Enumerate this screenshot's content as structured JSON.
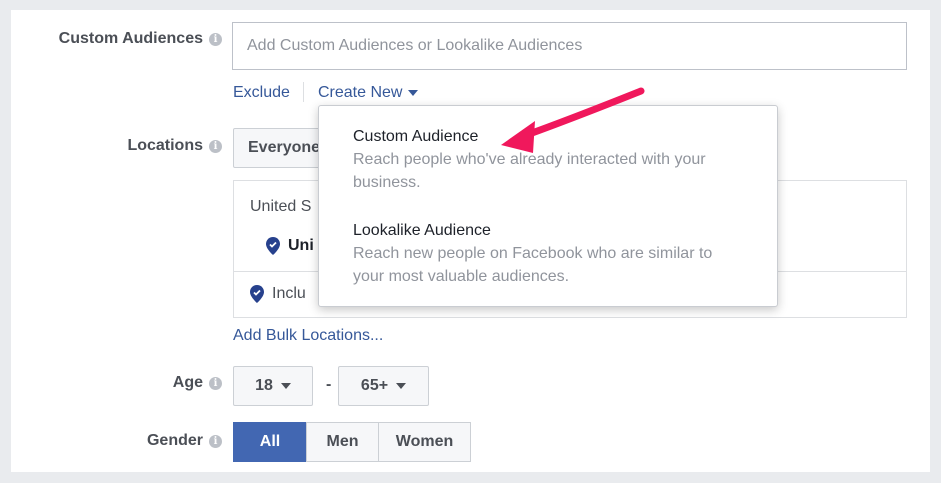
{
  "custom_audiences": {
    "label": "Custom Audiences",
    "info_icon": "info-icon",
    "placeholder": "Add Custom Audiences or Lookalike Audiences",
    "exclude_link": "Exclude",
    "create_new_link": "Create New"
  },
  "dropdown": {
    "items": [
      {
        "title": "Custom Audience",
        "description_line1": "Reach people who've already interacted with your",
        "description_line2": "business."
      },
      {
        "title": "Lookalike Audience",
        "description_line1": "Reach new people on Facebook who are similar to",
        "description_line2": "your most valuable audiences."
      }
    ]
  },
  "locations": {
    "label": "Locations",
    "selected": "Everyone",
    "country": "United S",
    "item": "Uni",
    "include_text": "Inclu",
    "bulk_link": "Add Bulk Locations..."
  },
  "age": {
    "label": "Age",
    "min": "18",
    "dash": "-",
    "max": "65+"
  },
  "gender": {
    "label": "Gender",
    "options": [
      "All",
      "Men",
      "Women"
    ],
    "selected": "All"
  },
  "colors": {
    "link": "#365899",
    "active_button": "#4267b2",
    "arrow": "#f0185c"
  }
}
